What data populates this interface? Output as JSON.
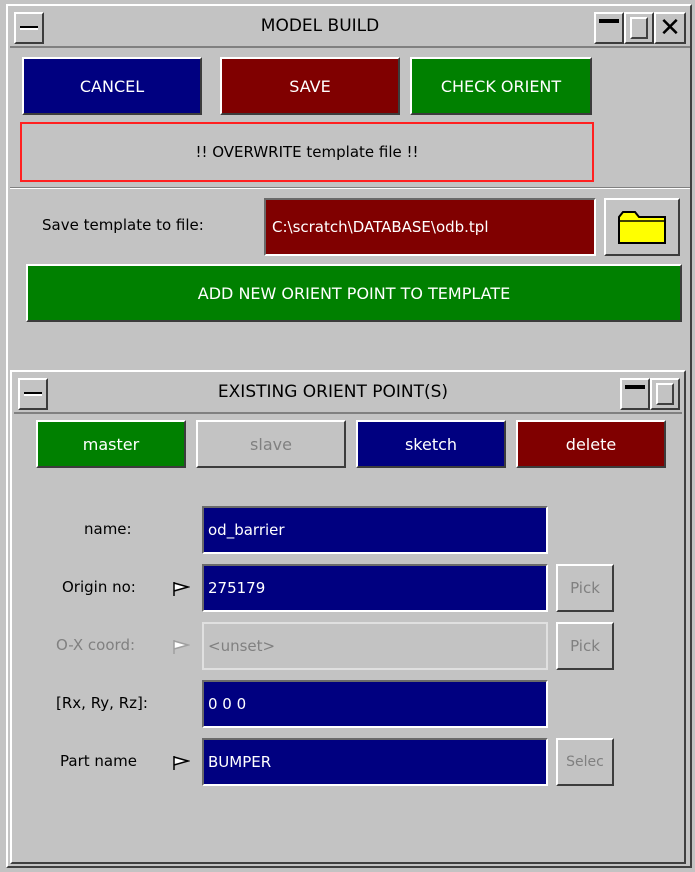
{
  "main_window": {
    "title": "MODEL BUILD",
    "buttons": {
      "cancel": "CANCEL",
      "save": "SAVE",
      "check_orient": "CHECK ORIENT"
    },
    "warning": "!! OVERWRITE template file !!",
    "save_label": "Save template to file:",
    "save_path": "C:\\scratch\\DATABASE\\odb.tpl",
    "add_point": "ADD NEW ORIENT POINT TO TEMPLATE"
  },
  "sub_window": {
    "title": "EXISTING ORIENT POINT(S)",
    "tabs": {
      "master": "master",
      "slave": "slave",
      "sketch": "sketch",
      "delete": "delete"
    },
    "fields": {
      "name_label": "name:",
      "name_value": "od_barrier",
      "origin_label": "Origin no:",
      "origin_value": "275179",
      "ox_label": "O-X coord:",
      "ox_value": "<unset>",
      "rot_label": "[Rx, Ry, Rz]:",
      "rot_value": "0 0 0",
      "part_label": "Part name",
      "part_value": "BUMPER"
    },
    "pick_label": "Pick",
    "select_label": "Selec"
  },
  "colors": {
    "navy": "#000080",
    "maroon": "#800000",
    "green": "#008000",
    "panel_grey": "#c3c3c3",
    "warning_border": "#ff2020"
  }
}
